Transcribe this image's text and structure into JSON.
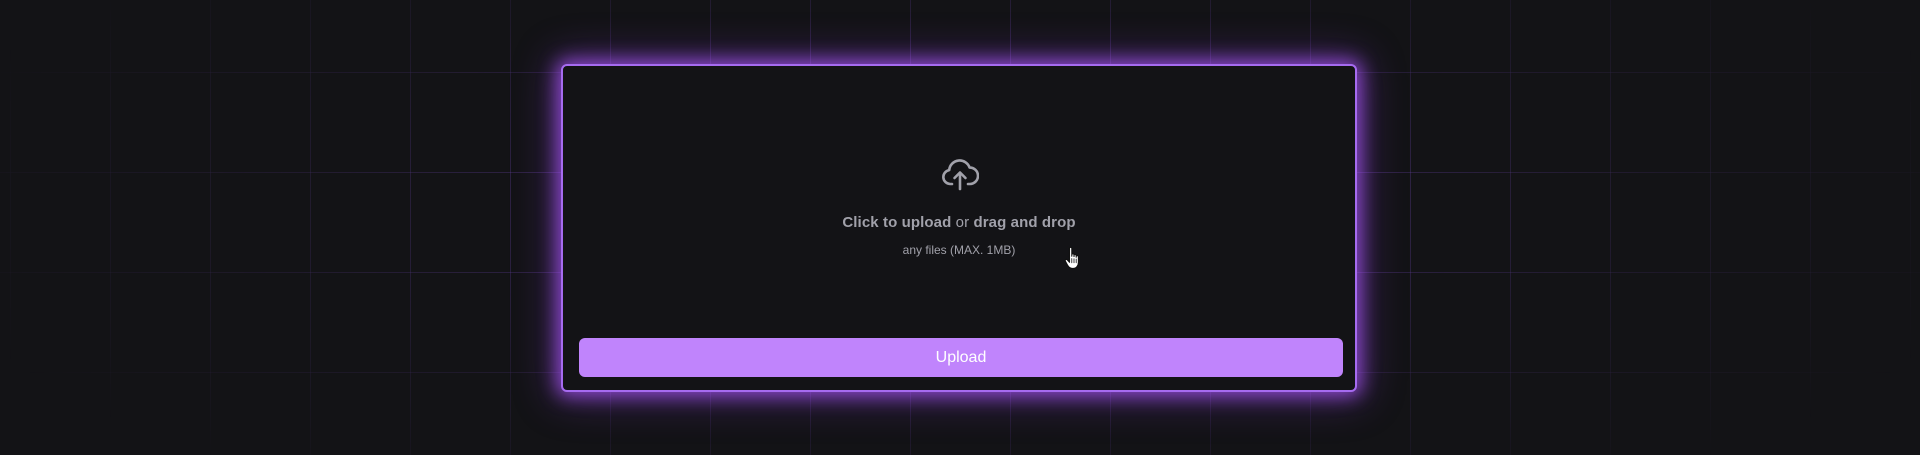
{
  "dropzone": {
    "icon": "cloud-upload-icon",
    "prompt_action": "Click to upload",
    "prompt_connector": "or",
    "prompt_alt": "drag and drop",
    "hint": "any files (MAX. 1MB)"
  },
  "upload_button": {
    "label": "Upload"
  },
  "cursor": {
    "icon": "hand-pointer-icon"
  },
  "colors": {
    "background": "#131316",
    "grid_line": "#7c4dc8",
    "card_border": "#a66bf0",
    "glow": "#a855f7",
    "button_bg": "#c084fc",
    "button_text": "#ffffff",
    "muted_text": "#a1a1aa"
  }
}
